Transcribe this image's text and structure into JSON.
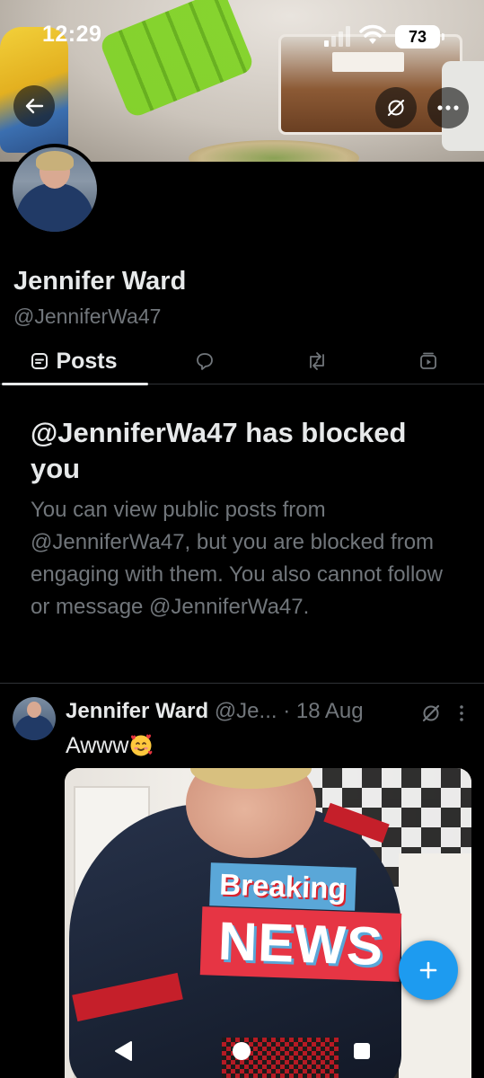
{
  "status_bar": {
    "time": "12:29",
    "battery": "73",
    "icons": [
      "signal-icon",
      "wifi-icon",
      "battery-icon"
    ]
  },
  "header": {
    "back_icon": "arrow-left-icon",
    "grok_icon": "grok-icon",
    "more_icon": "more-horizontal-icon"
  },
  "profile": {
    "name": "Jennifer Ward",
    "handle": "@JenniferWa47"
  },
  "tabs": [
    {
      "label": "Posts",
      "icon": "posts-icon",
      "active": true
    },
    {
      "label": "",
      "icon": "reply-bubble-icon",
      "active": false
    },
    {
      "label": "",
      "icon": "repost-icon",
      "active": false
    },
    {
      "label": "",
      "icon": "media-icon",
      "active": false
    }
  ],
  "blocked_notice": {
    "title": "@JenniferWa47 has blocked you",
    "body": "You can view public posts from @JenniferWa47, but you are blocked from engaging with them. You also cannot follow or message @JenniferWa47."
  },
  "post": {
    "author_name": "Jennifer Ward",
    "author_handle": "@Je...",
    "separator": "·",
    "date": "18 Aug",
    "text": "Awww",
    "emoji": "smiling-face-with-hearts",
    "image_overlay": {
      "line1": "Breaking",
      "line2": "NEWS"
    }
  },
  "fab": {
    "icon": "plus-icon"
  },
  "colors": {
    "background": "#000000",
    "primary_text": "#e7e9ea",
    "secondary_text": "#71767b",
    "accent": "#1d9bf0",
    "divider": "#2f3336"
  }
}
